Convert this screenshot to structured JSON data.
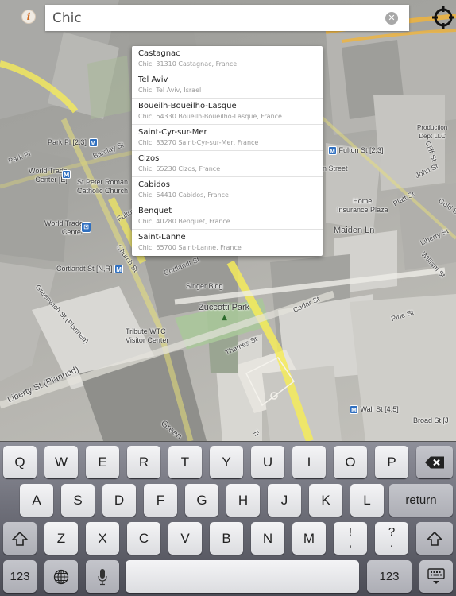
{
  "top_bar": {
    "info_icon_glyph": "i",
    "search": {
      "value": "Chic",
      "placeholder": ""
    },
    "clear_icon_glyph": "✕"
  },
  "suggestions": [
    {
      "title": "Castagnac",
      "subtitle": "Chic, 31310 Castagnac, France"
    },
    {
      "title": "Tel Aviv",
      "subtitle": "Chic, Tel Aviv, Israel"
    },
    {
      "title": "Boueilh-Boueilho-Lasque",
      "subtitle": "Chic, 64330 Boueilh-Boueilho-Lasque, France"
    },
    {
      "title": "Saint-Cyr-sur-Mer",
      "subtitle": "Chic, 83270 Saint-Cyr-sur-Mer, France"
    },
    {
      "title": "Cizos",
      "subtitle": "Chic, 65230 Cizos, France"
    },
    {
      "title": "Cabidos",
      "subtitle": "Chic, 64410 Cabidos, France"
    },
    {
      "title": "Benquet",
      "subtitle": "Chic, 40280 Benquet, France"
    },
    {
      "title": "Saint-Lanne",
      "subtitle": "Chic, 65700 Saint-Lanne, France"
    }
  ],
  "map": {
    "labels": {
      "park_pl": "Park Pl [2,3]",
      "park_pl_road": "Park Pl",
      "barclay_st": "Barclay St",
      "wtc_e_1": "World Trade",
      "wtc_e_2": "Center [E]",
      "st_peter_1": "St Peter Roman",
      "st_peter_2": "Catholic Church",
      "fulton_road": "Fulton St",
      "wtc_1": "World Trade",
      "wtc_2": "Center",
      "church_st": "Church St",
      "cortlandt_station": "Cortlandt St [N,R]",
      "cortlandt_road": "Cortlandt St",
      "greenwich_st": "Greenwich St (Planned)",
      "singer_bldg": "Singer Bldg",
      "zuccotti_park": "Zuccotti Park",
      "cedar_st": "Cedar St",
      "tribute_1": "Tribute WTC",
      "tribute_2": "Visitor Center",
      "thames_st": "Thames St",
      "liberty_planned": "Liberty St (Planned)",
      "pine_st": "Pine St",
      "wall_st": "Wall St [4,5]",
      "broad_st": "Broad St [J",
      "production_1": "Production",
      "production_2": "Dept LLC",
      "cliff_st": "Cliff St",
      "fulton_station": "Fulton St [2,3]",
      "street_partial": "n Street",
      "john_st": "John St",
      "home_ins_1": "Home",
      "home_ins_2": "Insurance Plaza",
      "platt_st": "Platt St",
      "gold_st": "Gold St",
      "maiden_ln": "Maiden Ln",
      "liberty_st": "Liberty St",
      "william_st": "William St",
      "green_partial": "Green",
      "trinity_partial": "Tr"
    },
    "metro_glyph": "M",
    "colors": {
      "major_road": "#f5eb5a",
      "highway": "#f0b43c",
      "park": "#a9c89a",
      "metro": "#2f6fbf"
    }
  },
  "keyboard": {
    "row1": [
      "Q",
      "W",
      "E",
      "R",
      "T",
      "Y",
      "U",
      "I",
      "O",
      "P"
    ],
    "row2": [
      "A",
      "S",
      "D",
      "F",
      "G",
      "H",
      "J",
      "K",
      "L"
    ],
    "row3": [
      "Z",
      "X",
      "C",
      "V",
      "B",
      "N",
      "M"
    ],
    "return_label": "return",
    "exclaim_top": "!",
    "exclaim_bottom": ",",
    "question_top": "?",
    "question_bottom": ".",
    "numbers_label": "123"
  }
}
